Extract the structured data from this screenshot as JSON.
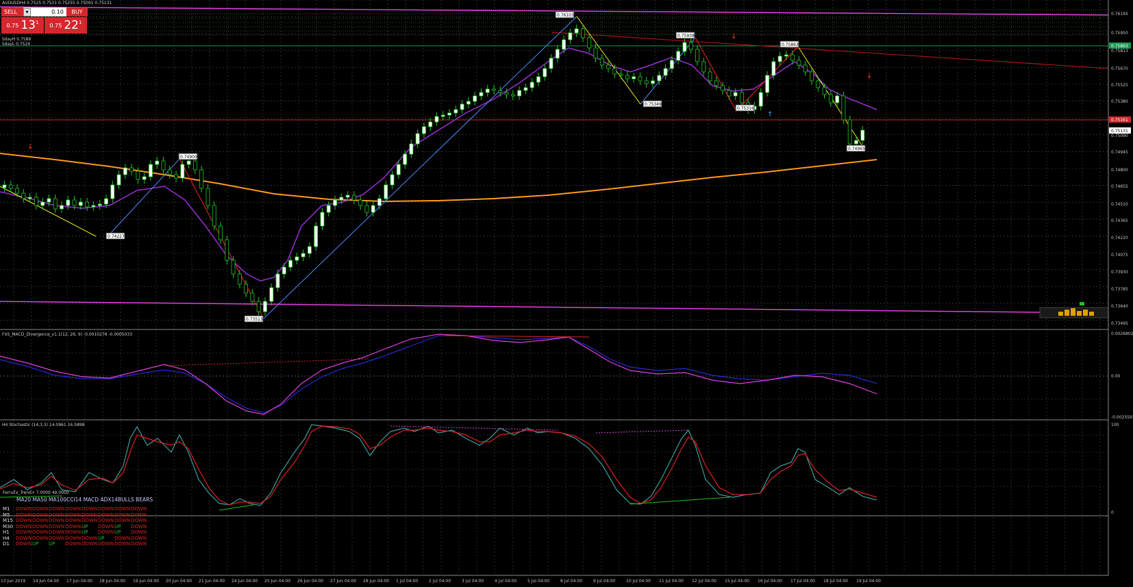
{
  "trade_panel": {
    "sell_label": "SELL",
    "buy_label": "BUY",
    "minus_label": "▾",
    "plus_label": "▴",
    "lot_value": "0.10",
    "sell_price_small": "0.75",
    "sell_price_big": "13",
    "sell_price_sup": "1",
    "buy_price_small": "0.75",
    "buy_price_big": "22",
    "buy_price_sup": "1"
  },
  "main_header": "AUDUSDH4  0.7525  0.7531  0.75255  0.75091  0.75131",
  "sday_high": "SdayH 0.7586",
  "sday_low": "SdayL 0.7524",
  "price_axis": [
    "0.76195",
    "0.75950",
    "0.75813",
    "0.75670",
    "0.75525",
    "0.75380",
    "0.75090",
    "0.74945",
    "0.74800",
    "0.74655",
    "0.74510",
    "0.74365",
    "0.74220",
    "0.74075",
    "0.73930",
    "0.73785",
    "0.73640",
    "0.73495"
  ],
  "price_tags": [
    {
      "text": "0.75863",
      "color": "#1a9850"
    },
    {
      "text": "0.75161",
      "color": "#d7262e"
    },
    {
      "text": "0.75131",
      "color": "#ffffff"
    }
  ],
  "swing_labels": [
    "0.76103",
    "0.75938",
    "0.75863",
    "0.75349",
    "0.75316",
    "0.74965",
    "0.74900",
    "0.74227",
    "0.73513"
  ],
  "time_axis": [
    "13 Jun 2019",
    "14 Jun 04:00",
    "17 Jun 04:00",
    "18 Jun 04:00",
    "19 Jun 04:00",
    "20 Jun 04:00",
    "21 Jun 04:00",
    "24 Jun 04:00",
    "25 Jun 04:00",
    "26 Jun 04:00",
    "27 Jun 04:00",
    "28 Jun 04:00",
    "1 Jul 04:00",
    "2 Jul 04:00",
    "3 Jul 04:00",
    "4 Jul 04:00",
    "5 Jul 04:00",
    "8 Jul 04:00",
    "9 Jul 04:00",
    "10 Jul 04:00",
    "11 Jul 04:00",
    "12 Jul 04:00",
    "15 Jul 04:00",
    "16 Jul 04:00",
    "17 Jul 04:00",
    "18 Jul 04:00",
    "19 Jul 04:00"
  ],
  "macd_header": "FXS_MACD_Divergence_v1.1(12, 26, 9) -0.0010276 -0.0005033",
  "macd_axis": [
    "0.0026802",
    "0.00",
    "-0.0025597"
  ],
  "stoch_header": "H4 Stochastic (14,3,3) 14.0961 16.5898",
  "stoch_axis": [
    "100",
    "0"
  ],
  "trend": {
    "title": "FerruFx_Trend+ 7.0000 49.0000",
    "header": "MA20  MA50  MA100CCI14  MACD ADX14BULLS BEARS",
    "rows": [
      {
        "tf": "M1",
        "cells": [
          "DOWN",
          "DOWN",
          "DOWN",
          "DOWN",
          "DOWN",
          "DOWN",
          "DOWN",
          "DOWN"
        ]
      },
      {
        "tf": "M5",
        "cells": [
          "DOWN",
          "DOWN",
          "DOWN",
          "DOWN",
          "DOWN",
          "DOWN",
          "DOWN",
          "DOWN"
        ]
      },
      {
        "tf": "M15",
        "cells": [
          "DOWN",
          "DOWN",
          "DOWN",
          "DOWN",
          "DOWN",
          "DOWN",
          "DOWN",
          "DOWN"
        ]
      },
      {
        "tf": "M30",
        "cells": [
          "DOWN",
          "DOWN",
          "DOWN",
          "DOWN",
          "UP",
          "DOWN",
          "UP",
          "DOWN"
        ]
      },
      {
        "tf": "H1",
        "cells": [
          "DOWN",
          "DOWN",
          "DOWN",
          "DOWN",
          "UP",
          "DOWN",
          "UP",
          "DOWN"
        ]
      },
      {
        "tf": "H4",
        "cells": [
          "DOWN",
          "DOWN",
          "DOWN",
          "DOWN",
          "DOWN",
          "UP",
          "DOWN",
          "DOWN"
        ]
      },
      {
        "tf": "D1",
        "cells": [
          "DOWN",
          "UP",
          "UP",
          "DOWN",
          "DOWN",
          "DOWN",
          "DOWN",
          "DOWN"
        ]
      }
    ]
  },
  "colors": {
    "background": "#000000",
    "grid": "#4a4a4a",
    "bull_candle": "#ffffff",
    "bear_candle": "#000000",
    "candle_outline": "#22c922",
    "ma_orange": "#ff9a1a",
    "ma_purple": "#9b2fd6",
    "magenta_line": "#e040e0",
    "zigzag_up": "#4d8cff",
    "zigzag_down": "#ff2020",
    "zigzag_yellow": "#f0f020",
    "macd_main": "#2828d8",
    "macd_signal": "#e040e0",
    "stoch_main": "#3aa0a0",
    "stoch_signal": "#e02020"
  }
}
